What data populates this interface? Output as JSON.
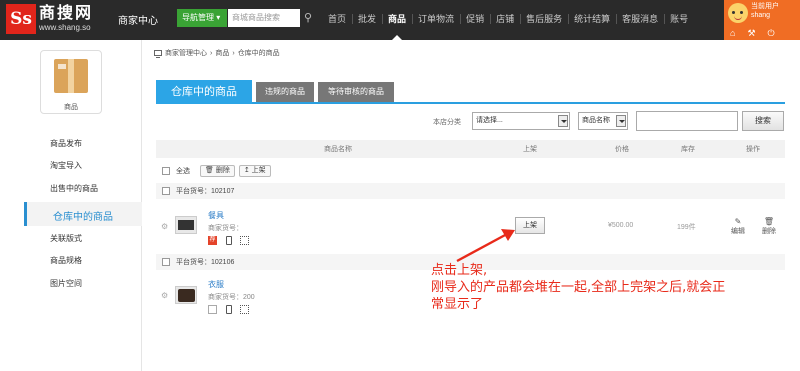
{
  "brand": {
    "mark": "Ss",
    "name": "商搜网",
    "url": "www.shang.so"
  },
  "header": {
    "center_title": "商家中心",
    "nav_button": "导航管理 ▾",
    "search_placeholder": "商城商品搜索",
    "menu": [
      "首页",
      "批发",
      "商品",
      "订单物流",
      "促销",
      "店铺",
      "售后服务",
      "统计结算",
      "客服消息",
      "账号"
    ],
    "active_menu": "商品",
    "user_line1": "当前用户",
    "user_line2": "shang"
  },
  "sidebar": {
    "box_label": "商品",
    "items": [
      "商品发布",
      "淘宝导入",
      "出售中的商品",
      "仓库中的商品",
      "关联版式",
      "商品规格",
      "图片空间"
    ],
    "active": "仓库中的商品"
  },
  "breadcrumb": [
    "商家管理中心",
    "商品",
    "仓库中的商品"
  ],
  "tabs": [
    "仓库中的商品",
    "违规的商品",
    "等待审核的商品"
  ],
  "filter": {
    "category_label": "本店分类",
    "category_value": "请选择...",
    "field_value": "商品名称",
    "search_button": "搜索"
  },
  "table": {
    "headers": [
      "商品名称",
      "上架",
      "价格",
      "库存",
      "操作"
    ],
    "select_all": "全选",
    "delete_label": "删除",
    "list_label": "上架",
    "groups": [
      {
        "code_label": "平台货号：102107",
        "name": "餐具",
        "merchant_code": "商家货号：",
        "badge": "荐",
        "list_button": "上架",
        "price": "¥500.00",
        "stock": "199件",
        "edit": "编辑",
        "delete": "删除"
      },
      {
        "code_label": "平台货号：102106",
        "name": "衣服",
        "merchant_code": "商家货号：200"
      }
    ]
  },
  "annotation": {
    "line1": "点击上架,",
    "line2": "刚导入的产品都会堆在一起,全部上完架之后,就会正",
    "line3": "常显示了",
    "color": "#e82a1a"
  }
}
